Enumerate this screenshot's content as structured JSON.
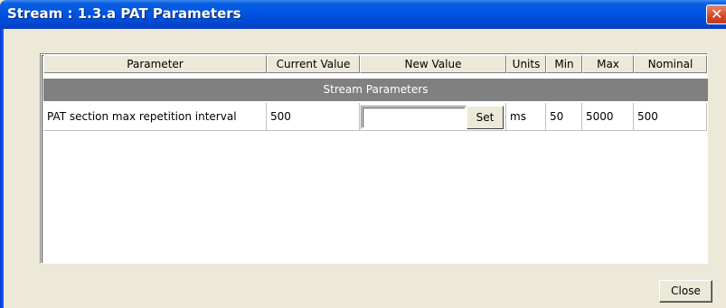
{
  "window": {
    "title": "Stream : 1.3.a PAT Parameters"
  },
  "table": {
    "columns": [
      "Parameter",
      "Current Value",
      "New Value",
      "Units",
      "Min",
      "Max",
      "Nominal"
    ],
    "section_label": "Stream Parameters",
    "rows": [
      {
        "parameter": "PAT section max repetition interval",
        "current_value": "500",
        "new_value": "",
        "units": "ms",
        "min": "50",
        "max": "5000",
        "nominal": "500"
      }
    ],
    "set_label": "Set"
  },
  "footer": {
    "close_label": "Close"
  },
  "icons": {
    "title_close": "close-icon"
  },
  "colors": {
    "titlebar": "#0054e3",
    "section_band": "#808080",
    "dialog_face": "#ece9d8"
  }
}
